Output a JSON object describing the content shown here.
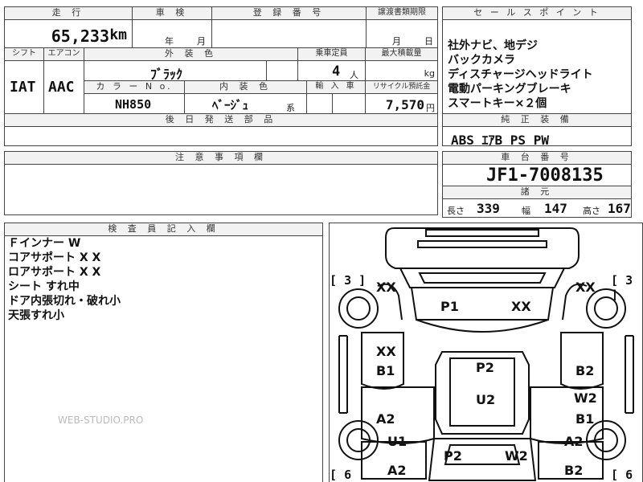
{
  "top_row": {
    "mileage_label": "走 行",
    "mileage_value": "65,233",
    "mileage_unit": "km",
    "inspection_label": "車 検",
    "inspection_year": "年",
    "inspection_month": "月",
    "registration_label": "登 録 番 号",
    "transfer_label": "譲渡書類期限",
    "transfer_month": "月",
    "transfer_day": "日"
  },
  "spec_row": {
    "shift_label": "シフト",
    "aircon_label": "エアコン",
    "shift_value": "IAT",
    "aircon_value": "AAC",
    "exterior_color_label": "外 装 色",
    "exterior_color_value": "ﾌﾞﾗｯｸ",
    "seating_label": "乗車定員",
    "seating_value": "4",
    "seating_unit": "人",
    "max_load_label": "最大積載量",
    "max_load_unit": "kg",
    "color_no_label": "カ ラ ー N o.",
    "color_no_value": "NH850",
    "interior_color_label": "内 装 色",
    "interior_color_value": "ﾍﾞｰｼﾞｭ",
    "interior_color_suffix": "系",
    "import_label": "輸 入 車",
    "recycle_label": "リサイクル預託金",
    "recycle_value": "7,570",
    "recycle_unit": "円",
    "parts_label": "後 日 発 送 部 品"
  },
  "notes": {
    "label": "注 意 事 項 欄"
  },
  "sales_points": {
    "label": "セ ー ル ス ポ イ ン ト",
    "items": [
      "社外ナビ、地デジ",
      "バックカメラ",
      "ディスチャージヘッドライト",
      "電動パーキングブレーキ",
      "スマートキー×２個"
    ]
  },
  "equipment": {
    "label": "純 正 装 備",
    "value": "ABS ｴｱB PS PW"
  },
  "chassis": {
    "label": "車 台 番 号",
    "value": "JF1-7008135",
    "dims_label": "諸 元",
    "length_label": "長さ",
    "length_value": "339",
    "width_label": "幅",
    "width_value": "147",
    "height_label": "高さ",
    "height_value": "167"
  },
  "inspector": {
    "label": "検 査 員 記 入 欄",
    "lines": [
      "Ｆインナー W",
      "コアサポート X X",
      "ロアサポート X X",
      "シート すれ中",
      "ドア内張切れ・破れ小",
      "天張すれ小"
    ],
    "watermark": "WEB-STUDIO.PRO"
  },
  "diagram": {
    "marks": [
      {
        "id": "fl",
        "text": "XX"
      },
      {
        "id": "fr",
        "text": "XX"
      },
      {
        "id": "hood1",
        "text": "P1"
      },
      {
        "id": "hood2",
        "text": "XX"
      },
      {
        "id": "lfender1",
        "text": "XX"
      },
      {
        "id": "lfender2",
        "text": "B1"
      },
      {
        "id": "roof1",
        "text": "P2"
      },
      {
        "id": "roof2",
        "text": "U2"
      },
      {
        "id": "rfender",
        "text": "B2"
      },
      {
        "id": "rdoor1",
        "text": "W2"
      },
      {
        "id": "rdoor2",
        "text": "B1"
      },
      {
        "id": "ldoor",
        "text": "A2"
      },
      {
        "id": "lrear1",
        "text": "U1"
      },
      {
        "id": "lrear2",
        "text": "A2"
      },
      {
        "id": "trunk1",
        "text": "P2"
      },
      {
        "id": "trunk2",
        "text": "W2"
      },
      {
        "id": "rrear1",
        "text": "A2"
      },
      {
        "id": "rrear2",
        "text": "B2"
      }
    ],
    "tire_fl": "3",
    "tire_fr": "3",
    "tire_rl": "6",
    "tire_rr": "6"
  }
}
